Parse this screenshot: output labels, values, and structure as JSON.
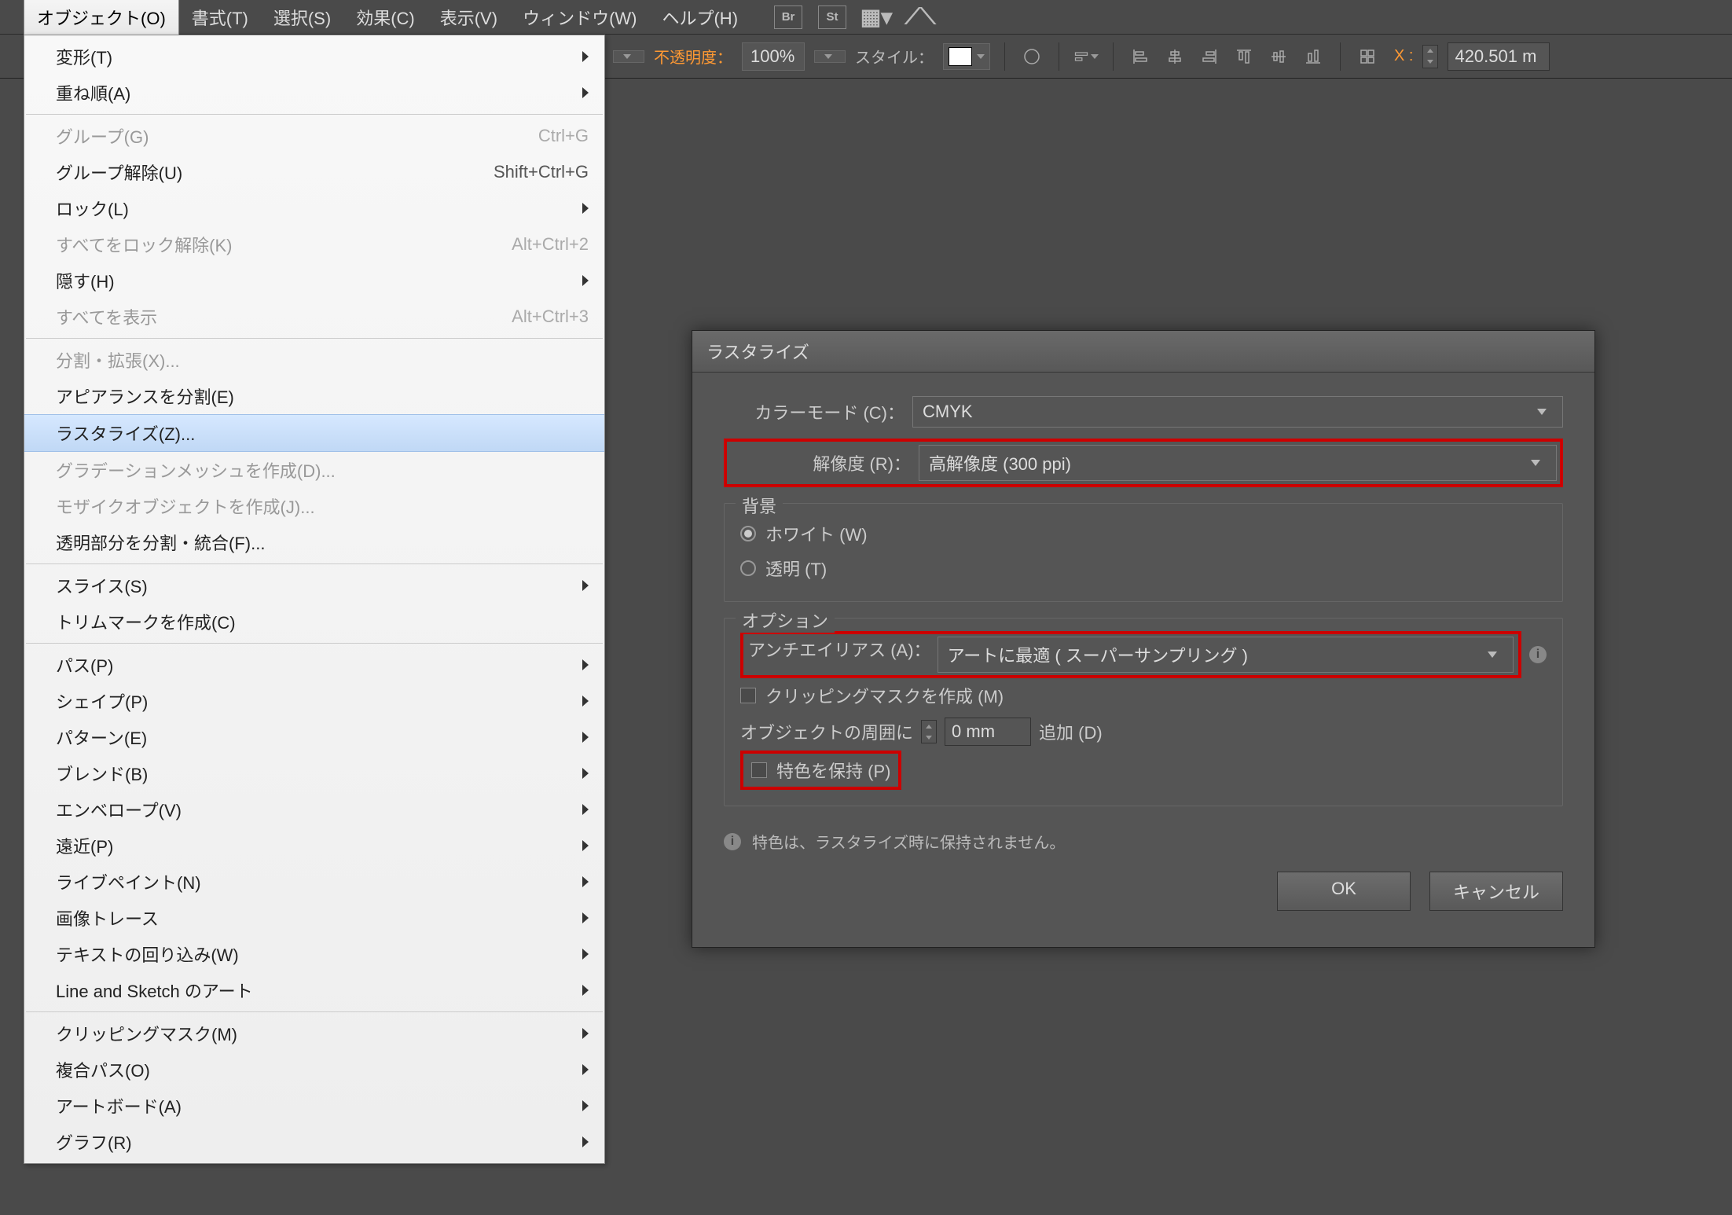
{
  "menubar": {
    "items": [
      {
        "label": "オブジェクト(O)",
        "active": true
      },
      {
        "label": "書式(T)"
      },
      {
        "label": "選択(S)"
      },
      {
        "label": "効果(C)"
      },
      {
        "label": "表示(V)"
      },
      {
        "label": "ウィンドウ(W)"
      },
      {
        "label": "ヘルプ(H)"
      }
    ],
    "icons": [
      "Br",
      "St"
    ]
  },
  "controlbar": {
    "opacity_label": "不透明度：",
    "opacity_value": "100%",
    "style_label": "スタイル：",
    "x_label": "X :",
    "x_value": "420.501 m"
  },
  "dropdown": {
    "groups": [
      [
        {
          "label": "変形(T)",
          "sub": true
        },
        {
          "label": "重ね順(A)",
          "sub": true
        }
      ],
      [
        {
          "label": "グループ(G)",
          "shortcut": "Ctrl+G",
          "disabled": true
        },
        {
          "label": "グループ解除(U)",
          "shortcut": "Shift+Ctrl+G"
        },
        {
          "label": "ロック(L)",
          "sub": true
        },
        {
          "label": "すべてをロック解除(K)",
          "shortcut": "Alt+Ctrl+2",
          "disabled": true
        },
        {
          "label": "隠す(H)",
          "sub": true
        },
        {
          "label": "すべてを表示",
          "shortcut": "Alt+Ctrl+3",
          "disabled": true
        }
      ],
      [
        {
          "label": "分割・拡張(X)...",
          "disabled": true
        },
        {
          "label": "アピアランスを分割(E)"
        },
        {
          "label": "ラスタライズ(Z)...",
          "highlight": true
        },
        {
          "label": "グラデーションメッシュを作成(D)...",
          "disabled": true
        },
        {
          "label": "モザイクオブジェクトを作成(J)...",
          "disabled": true
        },
        {
          "label": "透明部分を分割・統合(F)..."
        }
      ],
      [
        {
          "label": "スライス(S)",
          "sub": true
        },
        {
          "label": "トリムマークを作成(C)"
        }
      ],
      [
        {
          "label": "パス(P)",
          "sub": true
        },
        {
          "label": "シェイプ(P)",
          "sub": true
        },
        {
          "label": "パターン(E)",
          "sub": true
        },
        {
          "label": "ブレンド(B)",
          "sub": true
        },
        {
          "label": "エンベロープ(V)",
          "sub": true
        },
        {
          "label": "遠近(P)",
          "sub": true
        },
        {
          "label": "ライブペイント(N)",
          "sub": true
        },
        {
          "label": "画像トレース",
          "sub": true
        },
        {
          "label": "テキストの回り込み(W)",
          "sub": true
        },
        {
          "label": "Line and Sketch のアート",
          "sub": true
        }
      ],
      [
        {
          "label": "クリッピングマスク(M)",
          "sub": true
        },
        {
          "label": "複合パス(O)",
          "sub": true
        },
        {
          "label": "アートボード(A)",
          "sub": true
        },
        {
          "label": "グラフ(R)",
          "sub": true
        }
      ]
    ]
  },
  "dialog": {
    "title": "ラスタライズ",
    "colormode_label": "カラーモード (C)：",
    "colormode_value": "CMYK",
    "resolution_label": "解像度 (R)：",
    "resolution_value": "高解像度 (300 ppi)",
    "bg_legend": "背景",
    "bg_white": "ホワイト (W)",
    "bg_transparent": "透明 (T)",
    "opt_legend": "オプション",
    "aa_label": "アンチエイリアス (A)：",
    "aa_value": "アートに最適 ( スーパーサンプリング )",
    "clip_label": "クリッピングマスクを作成 (M)",
    "around_pre": "オブジェクトの周囲に",
    "around_value": "0 mm",
    "around_post": "追加 (D)",
    "spot_label": "特色を保持 (P)",
    "info_text": "特色は、ラスタライズ時に保持されません。",
    "ok": "OK",
    "cancel": "キャンセル"
  }
}
